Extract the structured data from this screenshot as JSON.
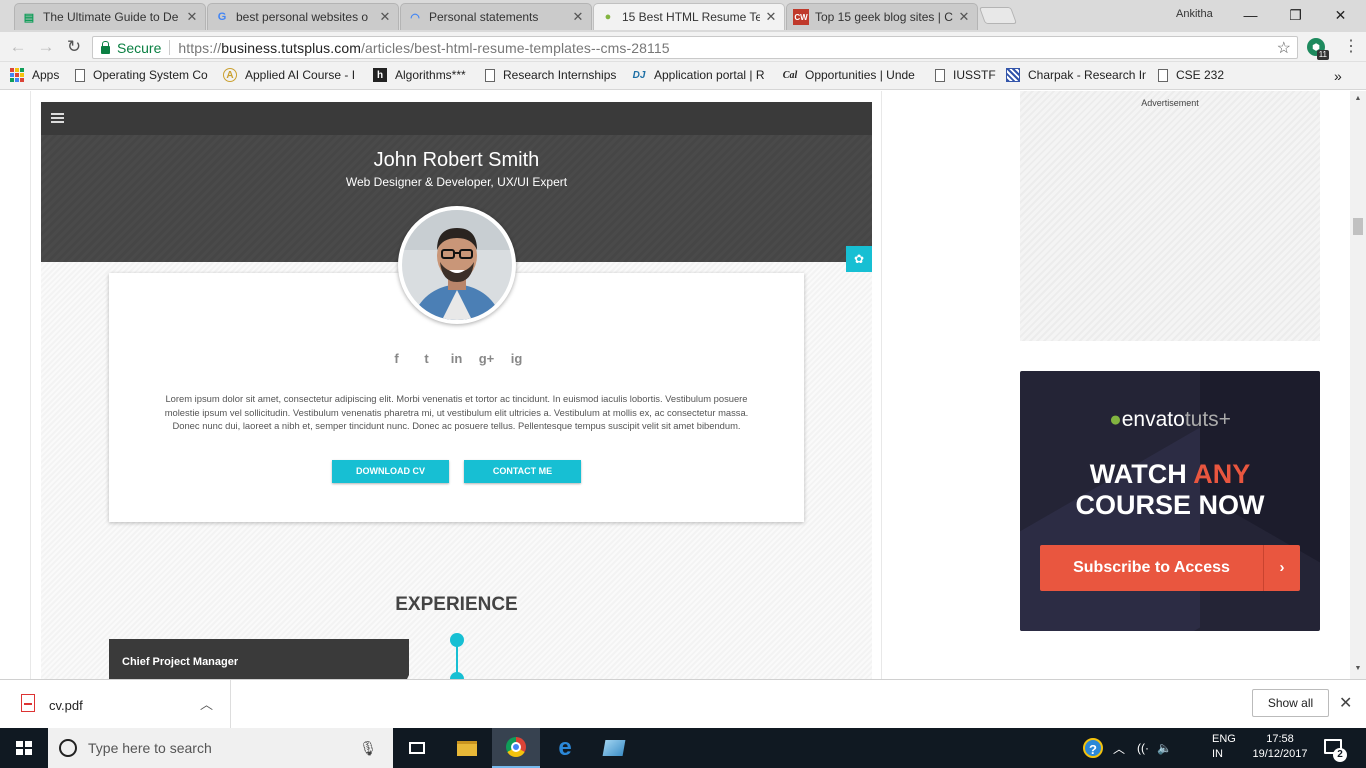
{
  "browser": {
    "tabs": [
      {
        "title": "The Ultimate Guide to De",
        "icon": "green-doc-icon",
        "active": false
      },
      {
        "title": "best personal websites o",
        "icon": "google-icon",
        "active": false
      },
      {
        "title": "Personal statements",
        "icon": "loading-spinner-icon",
        "active": false
      },
      {
        "title": "15 Best HTML Resume Te",
        "icon": "envato-leaf-icon",
        "active": true
      },
      {
        "title": "Top 15 geek blog sites | C",
        "icon": "cw-icon",
        "active": false
      }
    ],
    "user": "Ankitha",
    "security_label": "Secure",
    "url_scheme": "https://",
    "url_host": "business.tutsplus.com",
    "url_path": "/articles/best-html-resume-templates--cms-28115",
    "extension_badge": "11",
    "bookmarks": [
      {
        "label": "Apps",
        "icon": "apps-grid-icon"
      },
      {
        "label": "Operating System Co",
        "icon": "page-icon"
      },
      {
        "label": "Applied AI Course - I",
        "icon": "aai-icon"
      },
      {
        "label": "Algorithms***",
        "icon": "h-icon"
      },
      {
        "label": "Research Internships",
        "icon": "page-icon"
      },
      {
        "label": "Application portal | R",
        "icon": "dj-icon"
      },
      {
        "label": "Opportunities | Unde",
        "icon": "cal-icon"
      },
      {
        "label": "IUSSTF",
        "icon": "page-icon"
      },
      {
        "label": "Charpak - Research In",
        "icon": "charpak-icon"
      },
      {
        "label": "CSE 232",
        "icon": "page-icon"
      }
    ],
    "bookmarks_overflow": "»"
  },
  "resume": {
    "name": "John Robert Smith",
    "role": "Web Designer & Developer, UX/UI Expert",
    "social": [
      "f",
      "t",
      "in",
      "g+",
      "ig"
    ],
    "bio": "Lorem ipsum dolor sit amet, consectetur adipiscing elit. Morbi venenatis et tortor ac tincidunt. In euismod iaculis lobortis. Vestibulum posuere molestie ipsum vel sollicitudin. Vestibulum venenatis pharetra mi, ut vestibulum elit ultricies a. Vestibulum at mollis ex, ac consectetur massa. Donec nunc dui, laoreet a nibh et, semper tincidunt nunc. Donec ac posuere tellus. Pellentesque tempus suscipit velit sit amet bibendum.",
    "download_label": "DOWNLOAD CV",
    "contact_label": "CONTACT ME",
    "experience_title": "EXPERIENCE",
    "job_title": "Chief Project Manager"
  },
  "ads": {
    "advertisement_label": "Advertisement",
    "envato_brand": "envato",
    "envato_suffix": "tuts+",
    "headline_1": "WATCH",
    "headline_any": "ANY",
    "headline_2": "COURSE NOW",
    "cta": "Subscribe to Access",
    "cta_arrow": "›"
  },
  "downloads": {
    "file": "cv.pdf",
    "show_all": "Show all"
  },
  "taskbar": {
    "search_placeholder": "Type here to search",
    "lang_1": "ENG",
    "lang_2": "IN",
    "time": "17:58",
    "date": "19/12/2017",
    "notifications": "2"
  },
  "colors": {
    "accent": "#17bfd3",
    "envato_orange": "#e9563f",
    "secure_green": "#0b8043"
  }
}
